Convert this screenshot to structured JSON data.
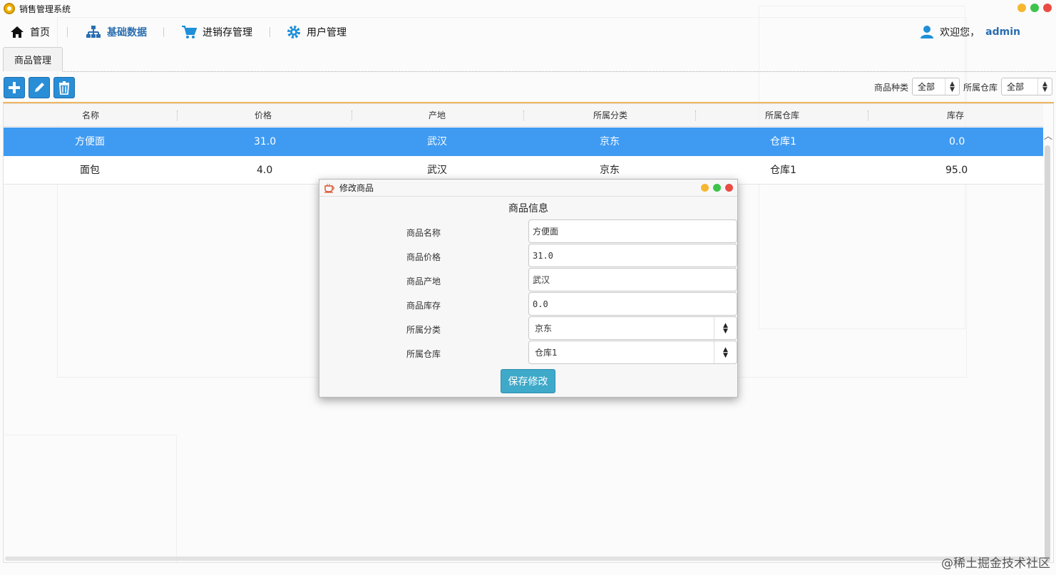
{
  "app": {
    "title": "销售管理系统"
  },
  "menu": {
    "items": [
      {
        "label": "首页",
        "icon": "home-icon"
      },
      {
        "label": "基础数据",
        "icon": "hierarchy-icon"
      },
      {
        "label": "进销存管理",
        "icon": "cart-icon"
      },
      {
        "label": "用户管理",
        "icon": "gear-icon"
      }
    ],
    "active_index": 1,
    "welcome_text": "欢迎您，",
    "username": "admin"
  },
  "tab": {
    "label": "商品管理"
  },
  "filters": {
    "category_label": "商品种类",
    "category_value": "全部",
    "warehouse_label": "所属仓库",
    "warehouse_value": "全部"
  },
  "table": {
    "columns": [
      "名称",
      "价格",
      "产地",
      "所属分类",
      "所属仓库",
      "库存"
    ],
    "rows": [
      {
        "name": "方便面",
        "price": "31.0",
        "origin": "武汉",
        "category": "京东",
        "warehouse": "仓库1",
        "stock": "0.0",
        "selected": true
      },
      {
        "name": "面包",
        "price": "4.0",
        "origin": "武汉",
        "category": "京东",
        "warehouse": "仓库1",
        "stock": "95.0",
        "selected": false
      }
    ]
  },
  "dialog": {
    "title": "修改商品",
    "heading": "商品信息",
    "fields": [
      {
        "label": "商品名称",
        "value": "方便面"
      },
      {
        "label": "商品价格",
        "value": "31.0"
      },
      {
        "label": "商品产地",
        "value": "武汉"
      },
      {
        "label": "商品库存",
        "value": "0.0"
      }
    ],
    "selects": [
      {
        "label": "所属分类",
        "value": "京东"
      },
      {
        "label": "所属仓库",
        "value": "仓库1"
      }
    ],
    "save_label": "保存修改"
  },
  "watermark": "@稀土掘金技术社区",
  "colors": {
    "accent": "#2a8ed6",
    "selected_row": "#3f9bf2",
    "save_button": "#3fa9c9"
  }
}
